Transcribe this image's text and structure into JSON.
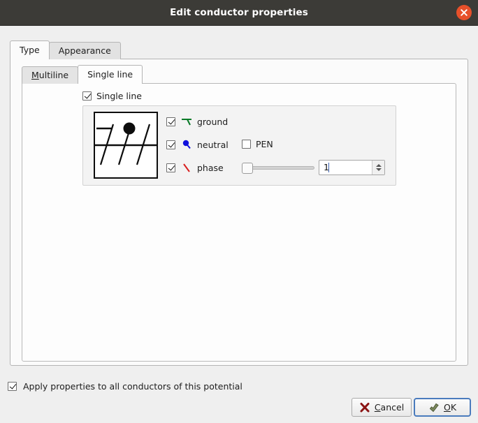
{
  "window": {
    "title": "Edit conductor properties",
    "close_icon": "close-icon",
    "close_color": "#e7502a",
    "titlebar_color": "#3c3b37"
  },
  "outer_tabs": [
    {
      "label": "Type",
      "active": true
    },
    {
      "label": "Appearance",
      "active": false
    }
  ],
  "inner_tabs": [
    {
      "label": "Multiline",
      "mnemonic": "M",
      "active": false
    },
    {
      "label": "Single line",
      "active": true
    }
  ],
  "single_line": {
    "label": "Single line",
    "checked": true
  },
  "conductors": [
    {
      "label": "ground",
      "checked": true,
      "icon": "ground-symbol-icon",
      "color": "#0a7a28"
    },
    {
      "label": "neutral",
      "checked": true,
      "icon": "neutral-symbol-icon",
      "color": "#1111dd"
    },
    {
      "label": "phase",
      "checked": true,
      "icon": "phase-symbol-icon",
      "color": "#d81f1f"
    }
  ],
  "pen": {
    "label": "PEN",
    "checked": false
  },
  "phase_count": {
    "value": "1",
    "slider_position": 0
  },
  "preview": {
    "name": "single-line-preview"
  },
  "apply_all": {
    "label": "Apply properties to all conductors of this potential",
    "checked": true
  },
  "buttons": {
    "cancel": {
      "label": "Cancel",
      "mnemonic": "C",
      "icon": "cancel-x-icon",
      "icon_color": "#8b1414"
    },
    "ok": {
      "label": "OK",
      "mnemonic": "O",
      "icon": "ok-arrow-icon",
      "icon_color": "#6f7d54",
      "focused": true
    }
  }
}
